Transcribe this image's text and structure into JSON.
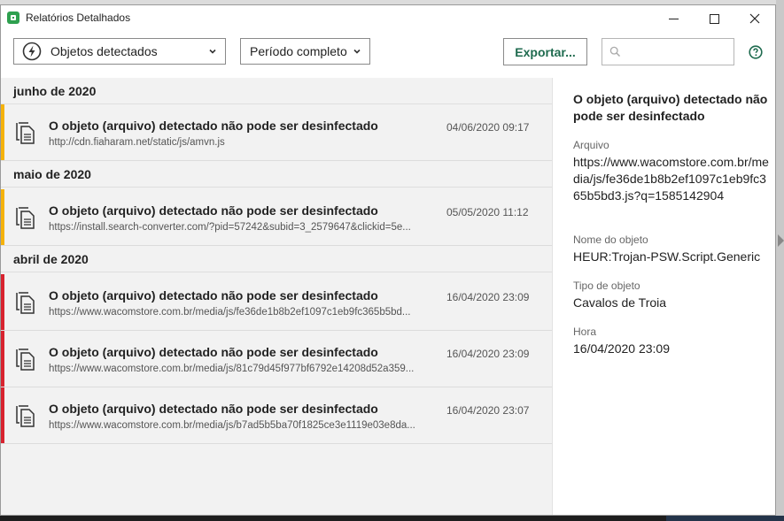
{
  "window": {
    "title": "Relatórios Detalhados"
  },
  "toolbar": {
    "filter_selected": "Objetos detectados",
    "period_selected": "Período completo",
    "export_label": "Exportar...",
    "search_placeholder": "",
    "search_value": ""
  },
  "groups": [
    {
      "label": "junho de 2020"
    },
    {
      "label": "maio de 2020"
    },
    {
      "label": "abril de 2020"
    }
  ],
  "items": [
    {
      "title": "O objeto (arquivo) detectado não pode ser desinfectado",
      "url": "http://cdn.fiaharam.net/static/js/amvn.js",
      "date": "04/06/2020 09:17",
      "severity": "warning"
    },
    {
      "title": "O objeto (arquivo) detectado não pode ser desinfectado",
      "url": "https://install.search-converter.com/?pid=57242&subid=3_2579647&clickid=5e...",
      "date": "05/05/2020 11:12",
      "severity": "warning"
    },
    {
      "title": "O objeto (arquivo) detectado não pode ser desinfectado",
      "url": "https://www.wacomstore.com.br/media/js/fe36de1b8b2ef1097c1eb9fc365b5bd...",
      "date": "16/04/2020 23:09",
      "severity": "danger"
    },
    {
      "title": "O objeto (arquivo) detectado não pode ser desinfectado",
      "url": "https://www.wacomstore.com.br/media/js/81c79d45f977bf6792e14208d52a359...",
      "date": "16/04/2020 23:09",
      "severity": "danger"
    },
    {
      "title": "O objeto (arquivo) detectado não pode ser desinfectado",
      "url": "https://www.wacomstore.com.br/media/js/b7ad5b5ba70f1825ce3e1119e03e8da...",
      "date": "16/04/2020 23:07",
      "severity": "danger"
    }
  ],
  "details": {
    "title": "O objeto (arquivo) detectado não pode ser desinfectado",
    "file_label": "Arquivo",
    "file_value": "https://www.wacomstore.com.br/media/js/fe36de1b8b2ef1097c1eb9fc365b5bd3.js?q=1585142904",
    "object_name_label": "Nome do objeto",
    "object_name_value": "HEUR:Trojan-PSW.Script.Generic",
    "object_type_label": "Tipo de objeto",
    "object_type_value": "Cavalos de Troia",
    "time_label": "Hora",
    "time_value": "16/04/2020 23:09"
  },
  "colors": {
    "brand": "#1f6b4f",
    "warning": "#f5b20a",
    "danger": "#d8232f",
    "app_icon": "#2ea04f"
  },
  "icons": {
    "app": "kaspersky-shield-icon",
    "filter": "threat-bolt-icon",
    "item": "document-copy-icon",
    "search": "search-icon",
    "help": "help-circle-icon"
  }
}
